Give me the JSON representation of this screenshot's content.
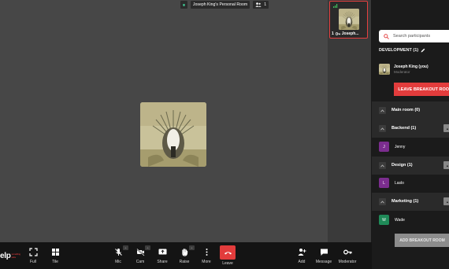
{
  "topbar": {
    "room_name": "Joseph King's Personal Room",
    "participant_count": "1"
  },
  "self_view": {
    "name": "Joseph..."
  },
  "toolbar": {
    "brand": "elp",
    "brand_tag": "something extra",
    "full_label": "Full",
    "tile_label": "Tile",
    "mic_label": "Mic",
    "cam_label": "Cam",
    "share_label": "Share",
    "raise_label": "Raise",
    "more_label": "More",
    "leave_label": "Leave",
    "add_label": "Add",
    "message_label": "Message",
    "moderator_label": "Moderator"
  },
  "panel": {
    "search_placeholder": "Search participants",
    "current_room": "DEVELOPMENT (1)",
    "me": {
      "name": "Joseph King (you)",
      "role": "Moderator"
    },
    "leave_room_label": "LEAVE BREAKOUT ROOM",
    "rooms": [
      {
        "title": "Main room (0)",
        "members": []
      },
      {
        "title": "Backend (1)",
        "members": [
          {
            "initial": "J",
            "name": "Jenny",
            "color": "#7b2d8e"
          }
        ]
      },
      {
        "title": "Design (1)",
        "members": [
          {
            "initial": "L",
            "name": "Laslo",
            "color": "#7b2d8e"
          }
        ]
      },
      {
        "title": "Marketing (1)",
        "members": [
          {
            "initial": "W",
            "name": "Wade",
            "color": "#1f8a58"
          }
        ]
      }
    ],
    "add_room_label": "ADD BREAKOUT ROOM"
  },
  "colors": {
    "accent_red": "#e23c3c",
    "stage": "#474747",
    "panel": "#1b1b1b"
  }
}
